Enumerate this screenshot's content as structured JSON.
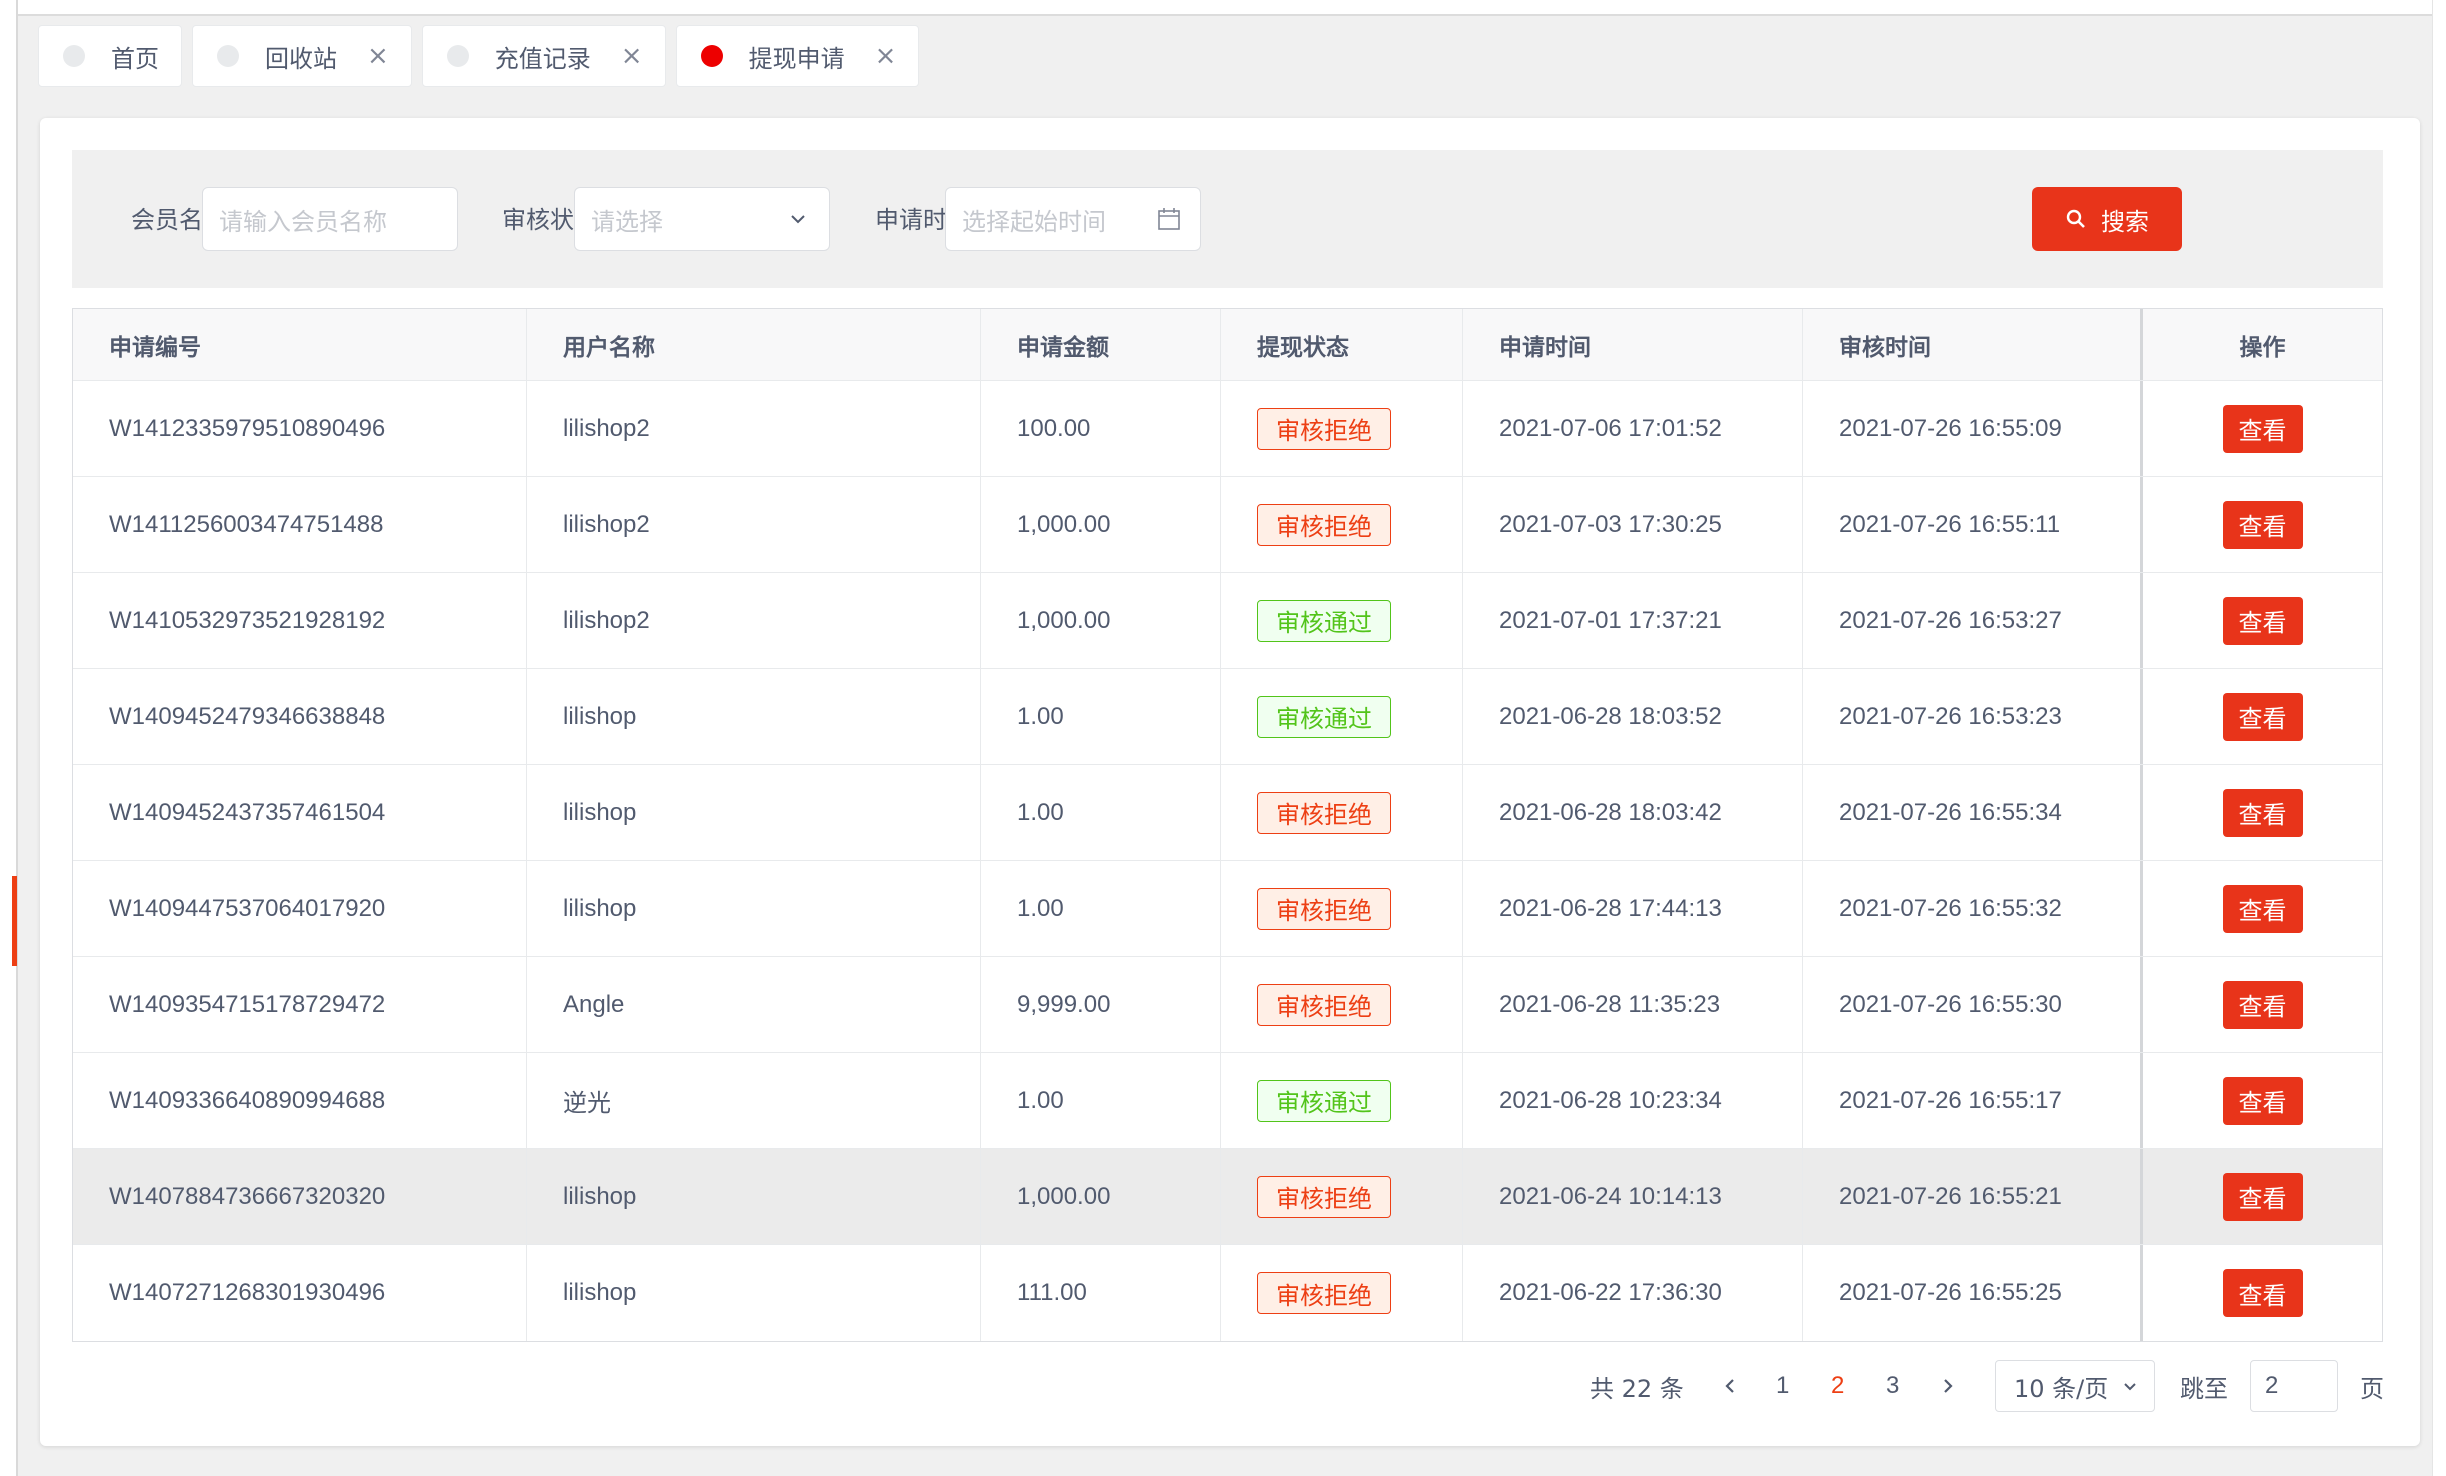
{
  "tabs": [
    {
      "label": "首页",
      "active": false,
      "closable": false
    },
    {
      "label": "回收站",
      "active": false,
      "closable": true
    },
    {
      "label": "充值记录",
      "active": false,
      "closable": true
    },
    {
      "label": "提现申请",
      "active": true,
      "closable": true
    }
  ],
  "filters": {
    "member_label": "会员名称",
    "member_placeholder": "请输入会员名称",
    "status_label": "审核状态",
    "status_placeholder": "请选择",
    "time_label": "申请时间",
    "time_placeholder": "选择起始时间",
    "search_label": "搜索"
  },
  "table": {
    "headers": [
      "申请编号",
      "用户名称",
      "申请金额",
      "提现状态",
      "申请时间",
      "审核时间",
      "操作"
    ],
    "rows": [
      {
        "id": "W1412335979510890496",
        "user": "lilishop2",
        "amount": "100.00",
        "status": "审核拒绝",
        "status_type": "reject",
        "apply_time": "2021-07-06 17:01:52",
        "audit_time": "2021-07-26 16:55:09",
        "action": "查看"
      },
      {
        "id": "W1411256003474751488",
        "user": "lilishop2",
        "amount": "1,000.00",
        "status": "审核拒绝",
        "status_type": "reject",
        "apply_time": "2021-07-03 17:30:25",
        "audit_time": "2021-07-26 16:55:11",
        "action": "查看"
      },
      {
        "id": "W1410532973521928192",
        "user": "lilishop2",
        "amount": "1,000.00",
        "status": "审核通过",
        "status_type": "pass",
        "apply_time": "2021-07-01 17:37:21",
        "audit_time": "2021-07-26 16:53:27",
        "action": "查看"
      },
      {
        "id": "W1409452479346638848",
        "user": "lilishop",
        "amount": "1.00",
        "status": "审核通过",
        "status_type": "pass",
        "apply_time": "2021-06-28 18:03:52",
        "audit_time": "2021-07-26 16:53:23",
        "action": "查看"
      },
      {
        "id": "W1409452437357461504",
        "user": "lilishop",
        "amount": "1.00",
        "status": "审核拒绝",
        "status_type": "reject",
        "apply_time": "2021-06-28 18:03:42",
        "audit_time": "2021-07-26 16:55:34",
        "action": "查看"
      },
      {
        "id": "W1409447537064017920",
        "user": "lilishop",
        "amount": "1.00",
        "status": "审核拒绝",
        "status_type": "reject",
        "apply_time": "2021-06-28 17:44:13",
        "audit_time": "2021-07-26 16:55:32",
        "action": "查看"
      },
      {
        "id": "W1409354715178729472",
        "user": "Angle",
        "amount": "9,999.00",
        "status": "审核拒绝",
        "status_type": "reject",
        "apply_time": "2021-06-28 11:35:23",
        "audit_time": "2021-07-26 16:55:30",
        "action": "查看"
      },
      {
        "id": "W1409336640890994688",
        "user": "逆光",
        "amount": "1.00",
        "status": "审核通过",
        "status_type": "pass",
        "apply_time": "2021-06-28 10:23:34",
        "audit_time": "2021-07-26 16:55:17",
        "action": "查看"
      },
      {
        "id": "W1407884736667320320",
        "user": "lilishop",
        "amount": "1,000.00",
        "status": "审核拒绝",
        "status_type": "reject",
        "apply_time": "2021-06-24 10:14:13",
        "audit_time": "2021-07-26 16:55:21",
        "action": "查看"
      },
      {
        "id": "W1407271268301930496",
        "user": "lilishop",
        "amount": "111.00",
        "status": "审核拒绝",
        "status_type": "reject",
        "apply_time": "2021-06-22 17:36:30",
        "audit_time": "2021-07-26 16:55:25",
        "action": "查看"
      }
    ],
    "hover_row_index": 8
  },
  "pagination": {
    "total_text": "共 22 条",
    "pages": [
      "1",
      "2",
      "3"
    ],
    "current_page": "2",
    "page_size": "10 条/页",
    "jump_label": "跳至",
    "jump_value": "2",
    "page_suffix": "页"
  },
  "colors": {
    "accent": "#e8341a",
    "reject": "#ed3f14",
    "pass": "#52c41a",
    "active_tab_dot": "#ed0000"
  }
}
